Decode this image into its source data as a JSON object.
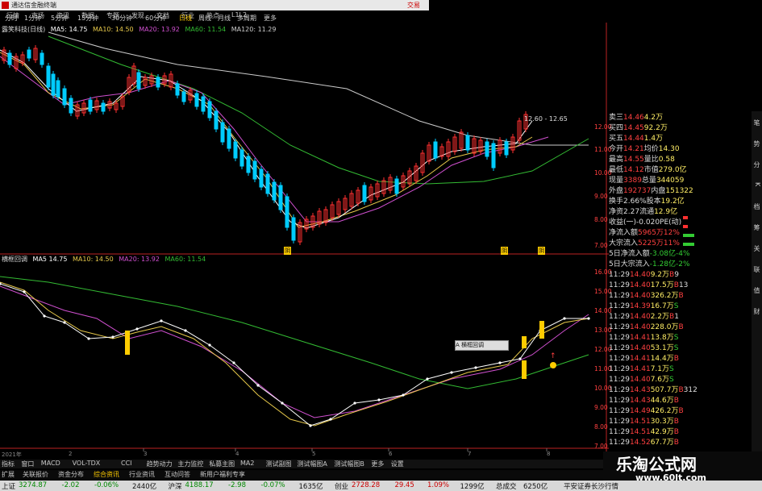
{
  "window": {
    "title": "通达信金融终端",
    "right_label": "交易"
  },
  "menu": [
    "行情",
    "市场",
    "资讯",
    "数据",
    "专题",
    "发现",
    "文档",
    "行业",
    "热点",
    "L1L2"
  ],
  "periods": [
    "分时",
    "1分钟",
    "5分钟",
    "15分钟",
    "30分钟",
    "60分钟",
    "日线",
    "周线",
    "月线",
    "多周期",
    "更多"
  ],
  "upper_legend": {
    "stock": "露笑科技(日线)",
    "ma5": "MA5: 14.75",
    "ma10": "MA10: 14.50",
    "ma20": "MA20: 13.92",
    "ma60": "MA60: 11.54",
    "ma120": "MA120: 11.29"
  },
  "lower_legend": {
    "name": "横框回调",
    "ma5": "MA5 14.75",
    "ma10": "MA10: 14.50",
    "ma20": "MA20: 13.92",
    "ma60": "MA60: 11.54"
  },
  "upper_axis": [
    "12.00",
    "11.00",
    "10.00",
    "9.00",
    "8.00",
    "7.00"
  ],
  "lower_axis": [
    "16.00",
    "15.00",
    "14.00",
    "13.00",
    "12.00",
    "11.00",
    "10.00",
    "9.00",
    "8.00",
    "7.00"
  ],
  "annotation": "12.60 - 12.65",
  "markers": [
    "阴",
    "阴",
    "阴"
  ],
  "tooltip": "A 横框回调",
  "dates": [
    "2021年",
    "2",
    "3",
    "4",
    "5",
    "6",
    "7",
    "8"
  ],
  "colors": {
    "ma5": "#ffffff",
    "ma10": "#e6c84a",
    "ma20": "#d050d0",
    "ma60": "#33bb33",
    "ma120": "#cccccc",
    "up": "#ff3030",
    "down": "#00ccff",
    "yellow": "#ffcc00",
    "cyan": "#55dddd"
  },
  "quote": {
    "sell_rows": [
      {
        "label": "卖三",
        "price": "14.46",
        "vol": "4.2万"
      },
      {
        "label": "买四",
        "price": "14.45",
        "vol": "92.2万"
      },
      {
        "label": "买五",
        "price": "14.44",
        "vol": "1.4万"
      }
    ],
    "stats": [
      {
        "l1": "今开",
        "v1": "14.21",
        "l2": "均价",
        "v2": "14.30"
      },
      {
        "l1": "最高",
        "v1": "14.55",
        "l2": "量比",
        "v2": "0.58"
      },
      {
        "l1": "最低",
        "v1": "14.12",
        "l2": "市值",
        "v2": "279.0亿"
      },
      {
        "l1": "现量",
        "v1": "3389",
        "l2": "总量",
        "v2": "344059"
      },
      {
        "l1": "外盘",
        "v1": "192737",
        "l2": "内盘",
        "v2": "151322"
      },
      {
        "l1": "换手",
        "v1": "2.66%",
        "l2": "股本",
        "v2": "19.2亿"
      },
      {
        "l1": "净资",
        "v1": "2.27",
        "l2": "流通",
        "v2": "12.9亿"
      },
      {
        "l1": "收益(一)",
        "v1": "-0.020",
        "l2": "PE(动)",
        "v2": ""
      }
    ],
    "flows": [
      {
        "label": "净流入额",
        "value": "5965万",
        "pct": "12%"
      },
      {
        "label": "大宗流入",
        "value": "5225万",
        "pct": "11%"
      },
      {
        "label": "5日净流入额",
        "value": "-3.08亿",
        "pct": "-4%"
      },
      {
        "label": "5日大宗流入",
        "value": "-1.28亿",
        "pct": "-2%"
      }
    ],
    "ticks": [
      {
        "t": "11:29",
        "p": "14.40",
        "v": "9.2万",
        "s": "B"
      },
      {
        "t": "11:29",
        "p": "14.40",
        "v": "17.5万",
        "s": "B"
      },
      {
        "t": "11:29",
        "p": "14.40",
        "v": "326.2万",
        "s": "B"
      },
      {
        "t": "11:29",
        "p": "14.39",
        "v": "16.7万",
        "s": "S"
      },
      {
        "t": "11:29",
        "p": "14.40",
        "v": "2.2万",
        "s": "B"
      },
      {
        "t": "11:29",
        "p": "14.40",
        "v": "228.0万",
        "s": "B"
      },
      {
        "t": "11:29",
        "p": "14.41",
        "v": "13.8万",
        "s": "S"
      },
      {
        "t": "11:29",
        "p": "14.40",
        "v": "53.1万",
        "s": "S"
      },
      {
        "t": "11:29",
        "p": "14.41",
        "v": "14.4万",
        "s": "B"
      },
      {
        "t": "11:29",
        "p": "14.41",
        "v": "7.1万",
        "s": "S"
      },
      {
        "t": "11:29",
        "p": "14.40",
        "v": "7.6万",
        "s": "S"
      },
      {
        "t": "11:29",
        "p": "14.43",
        "v": "507.7万",
        "s": "B"
      },
      {
        "t": "11:29",
        "p": "14.43",
        "v": "44.6万",
        "s": "B"
      },
      {
        "t": "11:29",
        "p": "14.49",
        "v": "426.2万",
        "s": "B"
      },
      {
        "t": "11:29",
        "p": "14.51",
        "v": "30.3万",
        "s": "B"
      },
      {
        "t": "11:29",
        "p": "14.51",
        "v": "42.9万",
        "s": "B"
      },
      {
        "t": "11:29",
        "p": "14.52",
        "v": "67.7万",
        "s": "B"
      }
    ],
    "tick_counts": [
      "9",
      "13",
      "",
      "",
      "1",
      "",
      "",
      "",
      "",
      "",
      "",
      "312",
      "",
      "",
      "",
      "",
      ""
    ]
  },
  "side_tabs": [
    "笔",
    "势",
    "分",
    "K",
    "档",
    "筹",
    "关",
    "联",
    "值",
    "财"
  ],
  "bottom_tabs": [
    "指标",
    "窗口",
    "MACD",
    "VOL-TDX",
    "CCI",
    "趋势动力",
    "主力监控",
    "私募主图",
    "MA2",
    "测试副图",
    "测试幅图A",
    "测试幅图B",
    "更多",
    "设置"
  ],
  "bottom_left": "扩展",
  "bottom_extra": [
    "关联报价",
    "资金分布",
    "综合资讯",
    "行业资讯",
    "互动问答",
    "新用户福利专享"
  ],
  "status": [
    {
      "label": "上证",
      "value": "3274.87",
      "chg": "-2.02",
      "pct": "-0.06%",
      "amt": "2440亿"
    },
    {
      "label": "沪深",
      "value": "4188.17",
      "chg": "-2.98",
      "pct": "-0.07%",
      "amt": "1635亿"
    },
    {
      "label": "创业",
      "value": "2728.28",
      "chg": "29.45",
      "pct": "1.09%",
      "amt": "1299亿"
    }
  ],
  "status_tail": [
    "总成交",
    "6250亿",
    "平安证券长沙行情"
  ],
  "watermark": {
    "title": "乐淘公式网",
    "url": "www.60lt.com"
  }
}
